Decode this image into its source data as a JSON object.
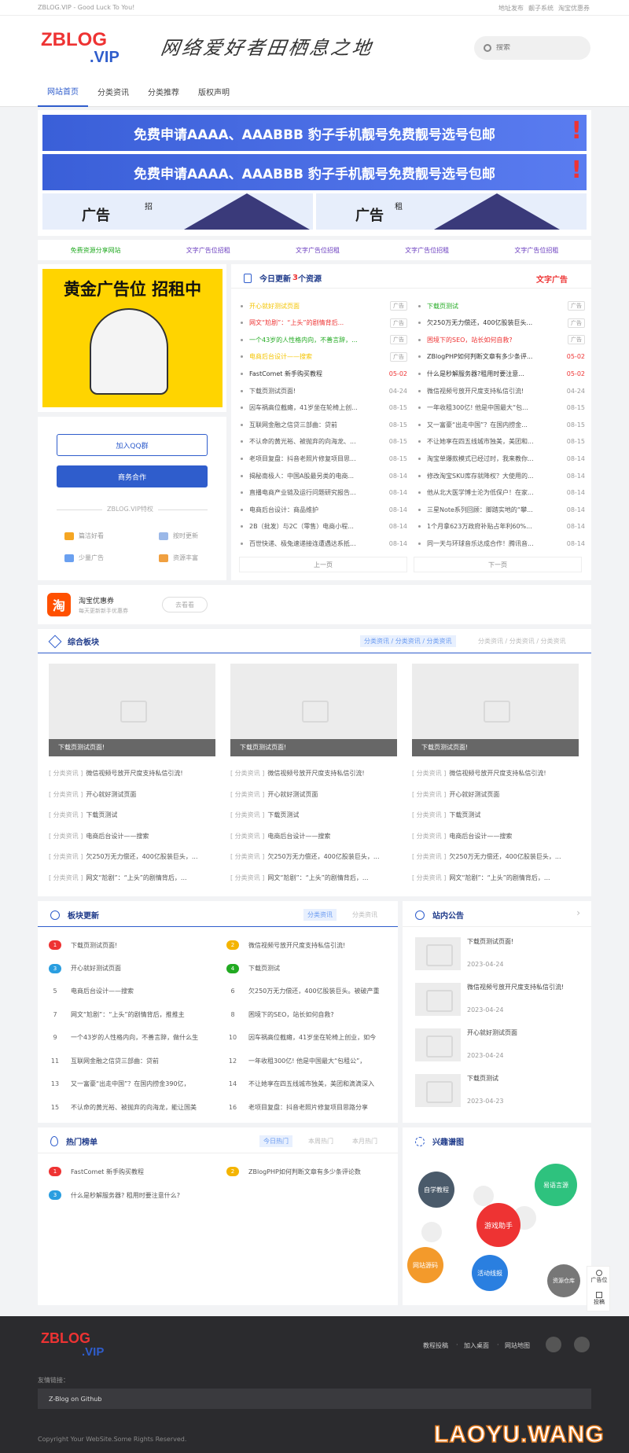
{
  "topbar": {
    "site": "ZBLOG.VIP - Good Luck To You!",
    "links": [
      "地址发布",
      "靓子系统",
      "淘宝优惠券"
    ]
  },
  "header": {
    "logo1": "ZBLOG",
    "logo2": ".VIP",
    "slogan": "网络爱好者田栖息之地",
    "search_placeholder": "搜索"
  },
  "nav": [
    "网站首页",
    "分类资讯",
    "分类推荐",
    "版权声明"
  ],
  "ads": {
    "banner": "免费申请AAAA、AAABBB 豹子手机靓号免费靓号选号包邮",
    "rent": "广告",
    "rent2": "招",
    "rent3": "租"
  },
  "text_ads": [
    "免费资源分享网站",
    "文字广告位招租",
    "文字广告位招租",
    "文字广告位招租",
    "文字广告位招租"
  ],
  "gold_ad": "黄金广告位 招租中",
  "side": {
    "qq": "加入QQ群",
    "biz": "商务合作",
    "feature_title": "ZBLOG.VIP特权",
    "features": [
      "篇洁好看",
      "按时更新",
      "少量广告",
      "资源丰富"
    ]
  },
  "today": {
    "title": "今日更新",
    "count": "3",
    "suffix": "个资源",
    "ad": "文字广告",
    "prev": "上一页",
    "next": "下一页",
    "left": [
      {
        "t": "开心就好测试页面",
        "d": "广告",
        "c": "#f4c400"
      },
      {
        "t": "网文“尬剧”：“上头”的剧情背后...",
        "d": "广告",
        "c": "#e33"
      },
      {
        "t": "一个43岁的人性格内向，不善言辞，...",
        "d": "广告",
        "c": "#2a2"
      },
      {
        "t": "电商后台设计——搜索",
        "d": "广告",
        "c": "#f4c400"
      },
      {
        "t": "FastComet 新手购买教程",
        "d": "05-02",
        "c": "#333",
        "dc": "#e33"
      },
      {
        "t": "下载页测试页面!",
        "d": "04-24"
      },
      {
        "t": "因车祸高位截瘫，41岁坐在轮椅上创...",
        "d": "08-15"
      },
      {
        "t": "互联网金融之信贷三部曲：贷前",
        "d": "08-15"
      },
      {
        "t": "不认命的黄光裕、被抛弃的向海龙、...",
        "d": "08-15"
      },
      {
        "t": "老项目复盘：抖音老照片修复项目思...",
        "d": "08-15"
      },
      {
        "t": "揭秘南极人：中国A股最另类的电商...",
        "d": "08-14"
      },
      {
        "t": "直播电商产业链及运行问题研究报告...",
        "d": "08-14"
      },
      {
        "t": "电商后台设计：商品维护",
        "d": "08-14"
      },
      {
        "t": "2B（批发）与2C（零售）电商小程...",
        "d": "08-14"
      },
      {
        "t": "百世快递、极兔速递接连遭遇达系抵...",
        "d": "08-14"
      }
    ],
    "right": [
      {
        "t": "下载页测试",
        "d": "广告",
        "c": "#2a2"
      },
      {
        "t": "欠250万无力偿还，400亿股装巨头...",
        "d": "广告",
        "c": "#333"
      },
      {
        "t": "困境下的SEO，站长如何自救?",
        "d": "广告",
        "c": "#e33"
      },
      {
        "t": "ZBlogPHP如何判断文章有多少条评...",
        "d": "05-02",
        "c": "#333",
        "dc": "#e33"
      },
      {
        "t": "什么是秒解服务器?租用时要注意...",
        "d": "05-02",
        "c": "#333",
        "dc": "#e33"
      },
      {
        "t": "微信视频号放开尺度支持私信引流!",
        "d": "04-24"
      },
      {
        "t": "一年收租300亿! 他是中国最大“包...",
        "d": "08-15"
      },
      {
        "t": "又一富豪“出走中国”？在国内捞金...",
        "d": "08-15"
      },
      {
        "t": "不让她享在四五线城市独美，美团和...",
        "d": "08-15"
      },
      {
        "t": "淘宝单爆款模式已经过时，我来教你...",
        "d": "08-14"
      },
      {
        "t": "修改淘宝SKU库存就降权？大使用的...",
        "d": "08-14"
      },
      {
        "t": "他从北大医学博士沦为低保户！在家...",
        "d": "08-14"
      },
      {
        "t": "三星Note系列回顾：脚踏实地的“攀...",
        "d": "08-14"
      },
      {
        "t": "1个月拿623万政府补贴占年利60%...",
        "d": "08-14"
      },
      {
        "t": "同一天与环球音乐达成合作！腾讯音...",
        "d": "08-14"
      }
    ]
  },
  "promo": {
    "name": "淘宝优惠券",
    "desc": "每天更新新手优惠券",
    "btn": "去看看",
    "icon": "淘"
  },
  "comp": {
    "title": "综合板块",
    "tabs1": "分类资讯 / 分类资讯 / 分类资讯",
    "tabs2": "分类资讯 / 分类资讯 / 分类资讯",
    "cards": [
      "下载页测试页面!",
      "下载页测试页面!",
      "下载页测试页面!"
    ],
    "cat": "[ 分类资讯 ]",
    "items": [
      "微信视频号放开尺度支持私信引流!",
      "开心就好测试页面",
      "下载页测试",
      "电商后台设计——搜索",
      "欠250万无力偿还，400亿股装巨头，...",
      "网文“尬剧”：“上头”的剧情背后，..."
    ]
  },
  "blocks": {
    "title": "板块更新",
    "tab1": "分类资讯",
    "tab2": "分类资讯",
    "items": [
      "下载页测试页面!",
      "微信视频号放开尺度支持私信引流!",
      "开心就好测试页面",
      "下载页测试",
      "电商后台设计——搜索",
      "欠250万无力偿还，400亿股装巨头。被破产重",
      "网文“尬剧”：“上头”的剧情背后，推推主",
      "困境下的SEO，站长如何自救?",
      "一个43岁的人性格内向，不善言辞，做什么生",
      "因车祸高位截瘫，41岁坐在轮椅上创业，如今",
      "互联网金融之信贷三部曲：贷前",
      "一年收租300亿! 他是中国最大“包租公”，",
      "又一富豪“出走中国”？在国内捞金390亿，",
      "不让她享在四五线城市独美，美团和滴滴深入",
      "不认命的黄光裕、被抛弃的向海龙，能让国美",
      "老项目复盘：抖音老照片修复项目思路分享"
    ],
    "nums": [
      "1",
      "2",
      "3",
      "4",
      "5",
      "6",
      "7",
      "8",
      "9",
      "10",
      "11",
      "12",
      "13",
      "14",
      "15",
      "16"
    ]
  },
  "notice": {
    "title": "站内公告",
    "items": [
      {
        "t": "下载页测试页面!",
        "d": "2023-04-24"
      },
      {
        "t": "微信视频号放开尺度支持私信引流!",
        "d": "2023-04-24"
      },
      {
        "t": "开心就好测试页面",
        "d": "2023-04-24"
      },
      {
        "t": "下载页测试",
        "d": "2023-04-23"
      }
    ]
  },
  "hot": {
    "title": "热门榜单",
    "tabs": [
      "今日热门",
      "本周热门",
      "本月热门"
    ],
    "items": [
      "FastComet 新手购买教程",
      "ZBlogPHP如何判断文章有多少条评论数",
      "什么是秒解服务器? 租用时要注意什么?"
    ],
    "nums": [
      "1",
      "2",
      "3"
    ]
  },
  "interest": {
    "title": "兴趣谱图",
    "bubbles": [
      "自学教程",
      "易语言源",
      "游戏助手",
      "网站源码",
      "活动线报",
      "资源仓库"
    ]
  },
  "float": {
    "ad": "广告位",
    "post": "投稿"
  },
  "footer": {
    "logo1": "ZBLOG",
    "logo2": ".VIP",
    "links": [
      "教程投稿",
      "加入桌面",
      "网站地图"
    ],
    "friend": "友情链接：",
    "github": "Z-Blog on Github",
    "copy": "Copyright Your WebSite.Some Rights Reserved.",
    "wm": "LAOYU.WANG"
  },
  "colors": {
    "accent": "#2f5dcc",
    "red": "#e33",
    "dark": "#2b2b2e"
  }
}
